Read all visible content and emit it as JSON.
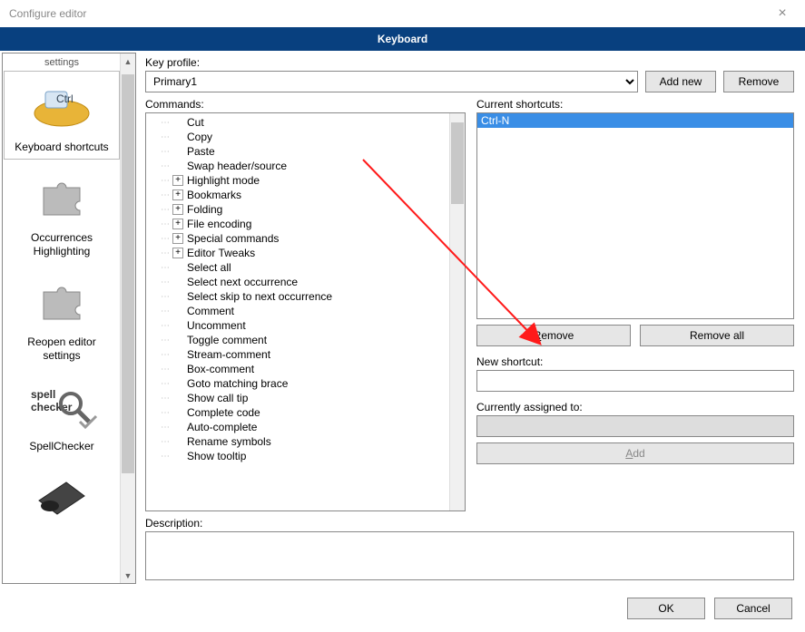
{
  "window": {
    "title": "Configure editor",
    "close_glyph": "×"
  },
  "banner": {
    "title": "Keyboard"
  },
  "sidebar": {
    "clipped_top": "settings",
    "items": [
      {
        "label": "Keyboard shortcuts",
        "selected": true
      },
      {
        "label": "Occurrences\nHighlighting",
        "selected": false
      },
      {
        "label": "Reopen editor\nsettings",
        "selected": false
      },
      {
        "label": "SpellChecker",
        "selected": false
      },
      {
        "label": "",
        "selected": false
      }
    ]
  },
  "profile": {
    "label": "Key profile:",
    "value": "Primary1",
    "add_new": "Add new",
    "remove": "Remove"
  },
  "commands": {
    "label": "Commands:",
    "tree": [
      {
        "label": "Cut",
        "expandable": false
      },
      {
        "label": "Copy",
        "expandable": false
      },
      {
        "label": "Paste",
        "expandable": false
      },
      {
        "label": "Swap header/source",
        "expandable": false
      },
      {
        "label": "Highlight mode",
        "expandable": true
      },
      {
        "label": "Bookmarks",
        "expandable": true
      },
      {
        "label": "Folding",
        "expandable": true
      },
      {
        "label": "File encoding",
        "expandable": true
      },
      {
        "label": "Special commands",
        "expandable": true
      },
      {
        "label": "Editor Tweaks",
        "expandable": true
      },
      {
        "label": "Select all",
        "expandable": false
      },
      {
        "label": "Select next occurrence",
        "expandable": false
      },
      {
        "label": "Select skip to next occurrence",
        "expandable": false
      },
      {
        "label": "Comment",
        "expandable": false
      },
      {
        "label": "Uncomment",
        "expandable": false
      },
      {
        "label": "Toggle comment",
        "expandable": false
      },
      {
        "label": "Stream-comment",
        "expandable": false
      },
      {
        "label": "Box-comment",
        "expandable": false
      },
      {
        "label": "Goto matching brace",
        "expandable": false
      },
      {
        "label": "Show call tip",
        "expandable": false
      },
      {
        "label": "Complete code",
        "expandable": false
      },
      {
        "label": "Auto-complete",
        "expandable": false
      },
      {
        "label": "Rename symbols",
        "expandable": false
      },
      {
        "label": "Show tooltip",
        "expandable": false
      }
    ]
  },
  "shortcuts": {
    "label": "Current shortcuts:",
    "items": [
      {
        "text": "Ctrl-N",
        "selected": true
      }
    ],
    "remove_prefix": "",
    "remove_accel": "R",
    "remove_suffix": "emove",
    "remove_all": "Remove all"
  },
  "new_shortcut": {
    "label": "New shortcut:",
    "value": ""
  },
  "assigned": {
    "label": "Currently assigned to:",
    "add_prefix": "",
    "add_accel": "A",
    "add_suffix": "dd"
  },
  "description": {
    "label": "Description:",
    "value": ""
  },
  "footer": {
    "ok": "OK",
    "cancel": "Cancel"
  }
}
